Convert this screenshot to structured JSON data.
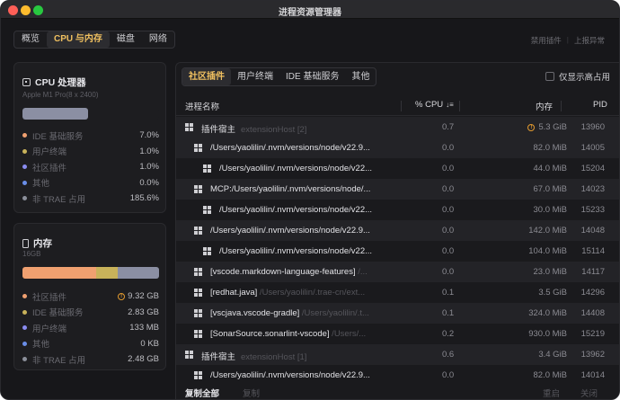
{
  "window": {
    "title": "进程资源管理器"
  },
  "top_tabs": [
    {
      "label": "概览",
      "active": false
    },
    {
      "label": "CPU 与内存",
      "active": true
    },
    {
      "label": "磁盘",
      "active": false
    },
    {
      "label": "网络",
      "active": false
    }
  ],
  "top_links": {
    "disable_plugins": "禁用插件",
    "report_issue": "上报异常"
  },
  "cpu_card": {
    "title": "CPU 处理器",
    "subtitle": "Apple M1 Pro(8 x 2400)",
    "usage_fraction": 0.48,
    "legend": [
      {
        "label": "IDE 基础服务",
        "value": "7.0%",
        "color": "#f0a070"
      },
      {
        "label": "用户终端",
        "value": "1.0%",
        "color": "#c8b25a"
      },
      {
        "label": "社区插件",
        "value": "1.0%",
        "color": "#8a8cf0"
      },
      {
        "label": "其他",
        "value": "0.0%",
        "color": "#6a8ee8"
      },
      {
        "label": "非 TRAE 占用",
        "value": "185.6%",
        "color": "#8b8f9a"
      }
    ]
  },
  "mem_card": {
    "title": "内存",
    "subtitle": "16GB",
    "segments": [
      {
        "fraction": 0.54,
        "color": "#f0a070"
      },
      {
        "fraction": 0.16,
        "color": "#c8b25a"
      },
      {
        "fraction": 0.3,
        "color": "#8b8fa3"
      }
    ],
    "legend": [
      {
        "label": "社区插件",
        "value": "9.32 GB",
        "color": "#f0a070",
        "warn": true
      },
      {
        "label": "IDE 基础服务",
        "value": "2.83 GB",
        "color": "#c8b25a",
        "warn": false
      },
      {
        "label": "用户终端",
        "value": "133 MB",
        "color": "#8a8cf0",
        "warn": false
      },
      {
        "label": "其他",
        "value": "0 KB",
        "color": "#6a8ee8",
        "warn": false
      },
      {
        "label": "非 TRAE 占用",
        "value": "2.48 GB",
        "color": "#8b8f9a",
        "warn": false
      }
    ]
  },
  "sub_tabs": [
    {
      "label": "社区插件",
      "active": true
    },
    {
      "label": "用户终端",
      "active": false
    },
    {
      "label": "IDE 基础服务",
      "active": false
    },
    {
      "label": "其他",
      "active": false
    }
  ],
  "high_only": {
    "label": "仅显示高占用",
    "checked": false
  },
  "table": {
    "columns": {
      "name": "进程名称",
      "cpu": "% CPU",
      "sort_glyph": "↓≡",
      "mem": "内存",
      "pid": "PID"
    },
    "rows": [
      {
        "indent": 0,
        "name": "插件宿主",
        "sub": "extensionHost [2]",
        "cpu": "0.7",
        "mem": "5.3 GiB",
        "pid": "13960",
        "warn": true
      },
      {
        "indent": 1,
        "name": "/Users/yaolilin/.nvm/versions/node/v22.9...",
        "sub": "",
        "cpu": "0.0",
        "mem": "82.0 MiB",
        "pid": "14005",
        "warn": false
      },
      {
        "indent": 2,
        "name": "/Users/yaolilin/.nvm/versions/node/v22...",
        "sub": "",
        "cpu": "0.0",
        "mem": "44.0 MiB",
        "pid": "15204",
        "warn": false
      },
      {
        "indent": 1,
        "name": "MCP:/Users/yaolilin/.nvm/versions/node/...",
        "sub": "",
        "cpu": "0.0",
        "mem": "67.0 MiB",
        "pid": "14023",
        "warn": false
      },
      {
        "indent": 2,
        "name": "/Users/yaolilin/.nvm/versions/node/v22...",
        "sub": "",
        "cpu": "0.0",
        "mem": "30.0 MiB",
        "pid": "15233",
        "warn": false
      },
      {
        "indent": 1,
        "name": "/Users/yaolilin/.nvm/versions/node/v22.9...",
        "sub": "",
        "cpu": "0.0",
        "mem": "142.0 MiB",
        "pid": "14048",
        "warn": false
      },
      {
        "indent": 2,
        "name": "/Users/yaolilin/.nvm/versions/node/v22...",
        "sub": "",
        "cpu": "0.0",
        "mem": "104.0 MiB",
        "pid": "15114",
        "warn": false
      },
      {
        "indent": 1,
        "name": "[vscode.markdown-language-features]",
        "sub": " /...",
        "cpu": "0.0",
        "mem": "23.0 MiB",
        "pid": "14117",
        "warn": false
      },
      {
        "indent": 1,
        "name": "[redhat.java]",
        "sub": " /Users/yaolilin/.trae-cn/ext...",
        "cpu": "0.1",
        "mem": "3.5 GiB",
        "pid": "14296",
        "warn": false
      },
      {
        "indent": 1,
        "name": "[vscjava.vscode-gradle]",
        "sub": " /Users/yaolilin/.t...",
        "cpu": "0.1",
        "mem": "324.0 MiB",
        "pid": "14408",
        "warn": false
      },
      {
        "indent": 1,
        "name": "[SonarSource.sonarlint-vscode]",
        "sub": " /Users/...",
        "cpu": "0.2",
        "mem": "930.0 MiB",
        "pid": "15219",
        "warn": false
      },
      {
        "indent": 0,
        "name": "插件宿主",
        "sub": "extensionHost [1]",
        "cpu": "0.6",
        "mem": "3.4 GiB",
        "pid": "13962",
        "warn": false
      },
      {
        "indent": 1,
        "name": "/Users/yaolilin/.nvm/versions/node/v22.9...",
        "sub": "",
        "cpu": "0.0",
        "mem": "82.0 MiB",
        "pid": "14014",
        "warn": false
      }
    ]
  },
  "footer": {
    "copy_all": "复制全部",
    "copy": "复制",
    "restart": "重启",
    "close": "关闭"
  }
}
